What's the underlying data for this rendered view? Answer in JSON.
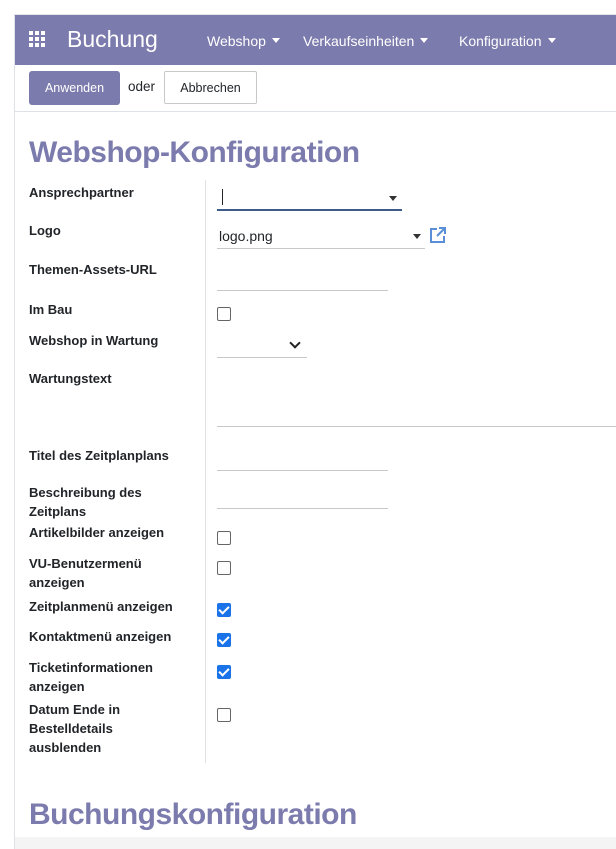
{
  "navbar": {
    "brand": "Buchung",
    "menus": [
      {
        "label": "Webshop"
      },
      {
        "label": "Verkaufseinheiten"
      },
      {
        "label": "Konfiguration"
      }
    ]
  },
  "control_panel": {
    "apply_label": "Anwenden",
    "or_label": "oder",
    "cancel_label": "Abbrechen"
  },
  "webshop_section": {
    "title": "Webshop-Konfiguration",
    "fields": {
      "ansprechpartner": {
        "label": "Ansprechpartner",
        "value": ""
      },
      "logo": {
        "label": "Logo",
        "value": "logo.png"
      },
      "themen_assets_url": {
        "label": "Themen-Assets-URL",
        "value": ""
      },
      "im_bau": {
        "label": "Im Bau",
        "checked": false
      },
      "webshop_in_wartung": {
        "label": "Webshop in Wartung",
        "value": ""
      },
      "wartungstext": {
        "label": "Wartungstext",
        "value": ""
      },
      "titel_zeitplanplans": {
        "label": "Titel des Zeitplanplans",
        "value": ""
      },
      "beschreibung_zeitplans": {
        "label": "Beschreibung des Zeitplans",
        "value": ""
      },
      "artikelbilder_anzeigen": {
        "label": "Artikelbilder anzeigen",
        "checked": false
      },
      "vu_benutzermenu_anzeigen": {
        "label": "VU-Benutzermenü anzeigen",
        "checked": false
      },
      "zeitplanmenu_anzeigen": {
        "label": "Zeitplanmenü anzeigen",
        "checked": true
      },
      "kontaktmenu_anzeigen": {
        "label": "Kontaktmenü anzeigen",
        "checked": true
      },
      "ticketinformationen_anzeigen": {
        "label": "Ticketinformationen anzeigen",
        "checked": true
      },
      "datum_ende_ausblenden": {
        "label": "Datum Ende in Bestelldetails ausblenden",
        "checked": false
      }
    }
  },
  "booking_section": {
    "title": "Buchungskonfiguration"
  },
  "colors": {
    "brand": "#7c7bad",
    "checkbox_checked": "#1a73e8",
    "focus_underline": "#3e5c89"
  },
  "icons": {
    "apps": "apps-grid-icon",
    "external_link": "external-link-icon"
  }
}
